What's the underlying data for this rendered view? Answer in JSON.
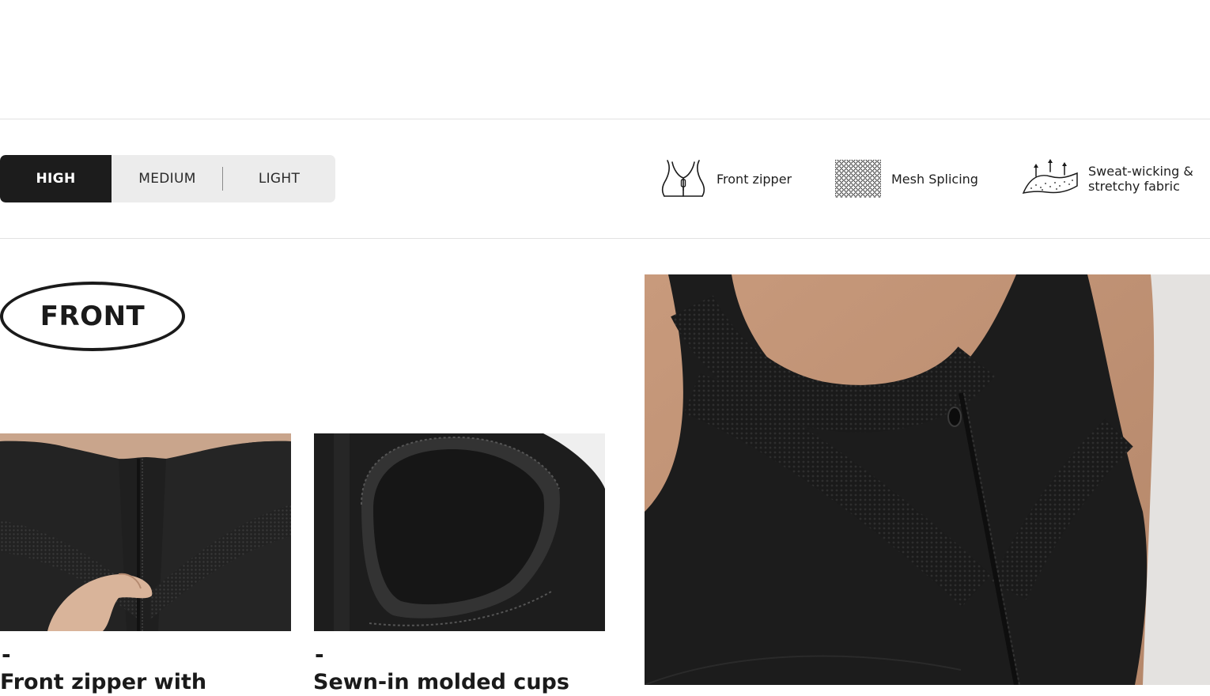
{
  "support_levels": {
    "items": [
      {
        "label": "HIGH",
        "selected": true
      },
      {
        "label": "MEDIUM",
        "selected": false
      },
      {
        "label": "LIGHT",
        "selected": false
      }
    ]
  },
  "features": [
    {
      "icon": "front-zipper-icon",
      "label": "Front zipper"
    },
    {
      "icon": "mesh-icon",
      "label": "Mesh Splicing"
    },
    {
      "icon": "sweat-wicking-icon",
      "label": "Sweat-wicking & stretchy fabric"
    }
  ],
  "section": {
    "title": "FRONT"
  },
  "details": [
    {
      "dash": "-",
      "caption": "Front zipper with"
    },
    {
      "dash": "-",
      "caption": "Sewn-in molded cups"
    }
  ],
  "colors": {
    "selected_bg": "#1c1c1c",
    "segment_bg": "#ececec",
    "divider": "#e2e2e2"
  }
}
